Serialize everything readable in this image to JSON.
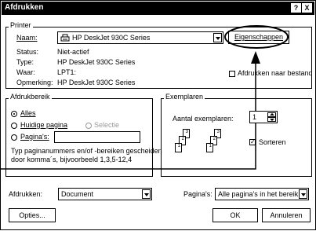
{
  "window": {
    "title": "Afdrukken",
    "help_label": "?",
    "close_label": "X"
  },
  "printer": {
    "group_label": "Printer",
    "name_label": "Naam:",
    "name_value": "HP DeskJet 930C Series",
    "properties_button": "Eigenschappen",
    "status_label": "Status:",
    "status_value": "Niet-actief",
    "type_label": "Type:",
    "type_value": "HP DeskJet 930C Series",
    "where_label": "Waar:",
    "where_value": "LPT1:",
    "comment_label": "Opmerking:",
    "comment_value": "HP DeskJet 930C Series",
    "print_to_file_label": "Afdrukken naar bestand",
    "print_to_file_checked": false
  },
  "range": {
    "group_label": "Afdrukbereik",
    "all_label": "Alles",
    "current_page_label": "Huidige pagina",
    "selection_label": "Selectie",
    "pages_label": "Pagina's:",
    "pages_value": "",
    "hint_line1": "Typ paginanummers en/of -bereiken gescheiden",
    "hint_line2": "door komma´s, bijvoorbeeld 1,3,5-12,4",
    "selected": "all"
  },
  "copies": {
    "group_label": "Exemplaren",
    "count_label": "Aantal exemplaren:",
    "count_value": "1",
    "collate_label": "Sorteren",
    "collate_checked": true,
    "page_numbers": [
      "1",
      "2",
      "3"
    ]
  },
  "bottom": {
    "print_what_label": "Afdrukken:",
    "print_what_value": "Document",
    "print_pages_label": "Pagina's:",
    "print_pages_value": "Alle pagina's in het bereik",
    "options_button": "Opties...",
    "ok_button": "OK",
    "cancel_button": "Annuleren"
  },
  "annotation": {
    "color": "#000000"
  }
}
